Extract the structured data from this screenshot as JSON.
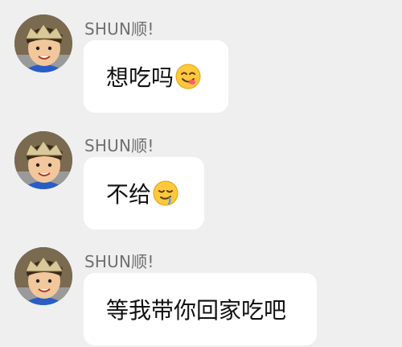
{
  "messages": [
    {
      "sender": "SHUN顺!",
      "text": "想吃吗",
      "emoji": "yum-face-emoji"
    },
    {
      "sender": "SHUN顺!",
      "text": "不给",
      "emoji": "drooling-face-emoji"
    },
    {
      "sender": "SHUN顺!",
      "text": "等我带你回家吃吧",
      "emoji": ""
    }
  ],
  "colors": {
    "background": "#efefef",
    "bubble": "#ffffff",
    "sender_text": "#707070",
    "message_text": "#111111"
  }
}
